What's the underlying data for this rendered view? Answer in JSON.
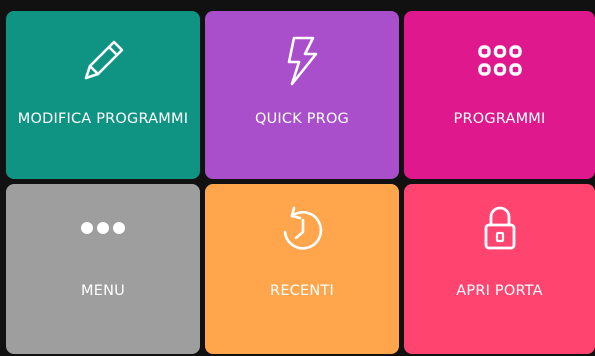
{
  "tiles": [
    {
      "id": "modifica-programmi",
      "label": "MODIFICA PROGRAMMI",
      "color": "#0f9484",
      "icon": "pencil-icon"
    },
    {
      "id": "quick-prog",
      "label": "QUICK PROG",
      "color": "#aa4fcb",
      "icon": "lightning-icon"
    },
    {
      "id": "programmi",
      "label": "PROGRAMMI",
      "color": "#e0188d",
      "icon": "grid-icon"
    },
    {
      "id": "menu",
      "label": "MENU",
      "color": "#9e9e9e",
      "icon": "more-dots-icon"
    },
    {
      "id": "recenti",
      "label": "RECENTI",
      "color": "#ffa64d",
      "icon": "history-clock-icon"
    },
    {
      "id": "apri-porta",
      "label": "APRI PORTA",
      "color": "#ff4470",
      "icon": "padlock-icon"
    }
  ]
}
